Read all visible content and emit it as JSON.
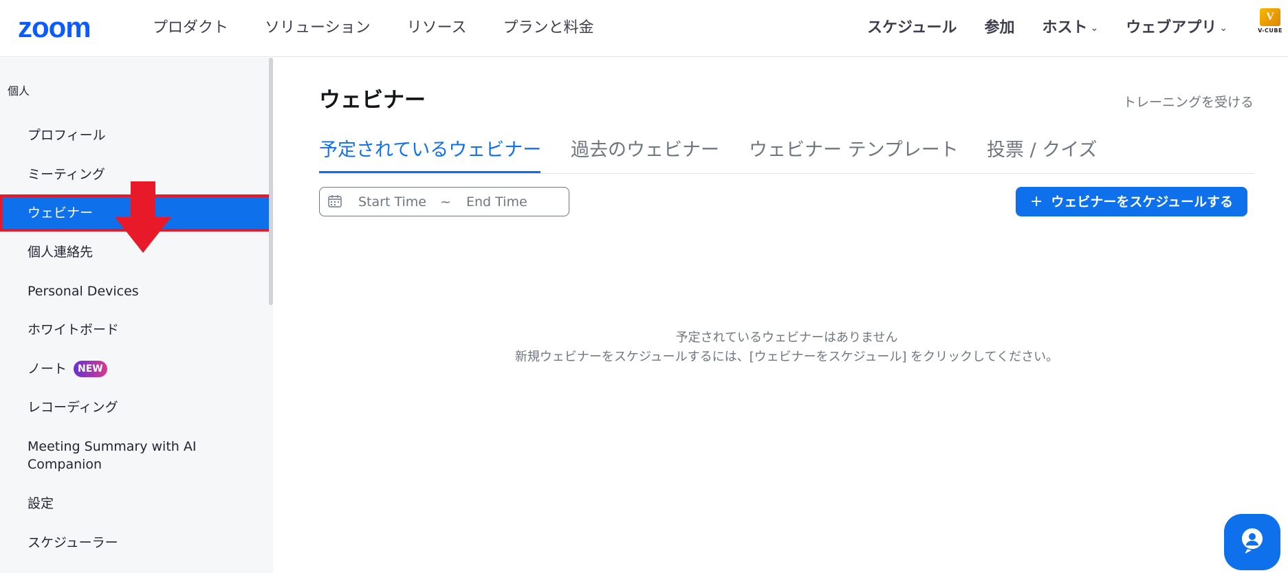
{
  "header": {
    "logo": "zoom",
    "nav_left": [
      "プロダクト",
      "ソリューション",
      "リソース",
      "プランと料金"
    ],
    "nav_right": [
      {
        "label": "スケジュール",
        "dropdown": false
      },
      {
        "label": "参加",
        "dropdown": false
      },
      {
        "label": "ホスト",
        "dropdown": true
      },
      {
        "label": "ウェブアプリ",
        "dropdown": true
      }
    ],
    "caret": "⌄",
    "partner_logo_mark": "V",
    "partner_logo_text": "V-CUBE"
  },
  "sidebar": {
    "section_label": "個人",
    "items": [
      {
        "label": "プロフィール"
      },
      {
        "label": "ミーティング"
      },
      {
        "label": "ウェビナー",
        "active": true
      },
      {
        "label": "個人連絡先"
      },
      {
        "label": "Personal Devices"
      },
      {
        "label": "ホワイトボード"
      },
      {
        "label": "ノート",
        "badge": "NEW"
      },
      {
        "label": "レコーディング"
      },
      {
        "label": "Meeting Summary with AI Companion"
      },
      {
        "label": "設定"
      },
      {
        "label": "スケジューラー"
      }
    ],
    "annotation": "red-down-arrow"
  },
  "main": {
    "title": "ウェビナー",
    "training_link": "トレーニングを受ける",
    "tabs": [
      {
        "label": "予定されているウェビナー",
        "active": true
      },
      {
        "label": "過去のウェビナー"
      },
      {
        "label": "ウェビナー テンプレート"
      },
      {
        "label": "投票 / クイズ"
      }
    ],
    "date_range": {
      "icon": "calendar-icon",
      "start_placeholder": "Start Time",
      "separator": "~",
      "end_placeholder": "End Time"
    },
    "schedule_button": {
      "icon": "+",
      "label": "ウェビナーをスケジュールする"
    },
    "empty_state": {
      "title": "予定されているウェビナーはありません",
      "description": "新規ウェビナーをスケジュールするには、[ウェビナーをスケジュール] をクリックしてください。"
    }
  },
  "chat_button": {
    "icon": "chat-bot-icon"
  },
  "colors": {
    "brand": "#0b5cff",
    "accent": "#0e71eb",
    "highlight_border": "#e81a2a",
    "sidebar_bg": "#f6f7f9"
  }
}
